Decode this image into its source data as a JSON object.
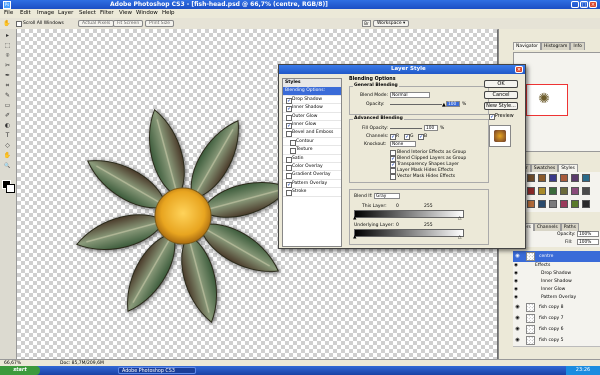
{
  "window": {
    "title": "Adobe Photoshop CS3 - [fish-head.psd @ 66,7% (centre, RGB/8)]"
  },
  "menu": [
    "File",
    "Edit",
    "Image",
    "Layer",
    "Select",
    "Filter",
    "View",
    "Window",
    "Help"
  ],
  "options": {
    "scroll_all": "Scroll All Windows",
    "actual_pixels": "Actual Pixels",
    "fit_screen": "Fit Screen",
    "print_size": "Print Size",
    "workspace": "Workspace ▾"
  },
  "tools": [
    "▸",
    "⬚",
    "⌾",
    "✂",
    "✒",
    "⌗",
    "✎",
    "▭",
    "✐",
    "◐",
    "T",
    "◇",
    "✋",
    "🔍"
  ],
  "dialog": {
    "title": "Layer Style",
    "styles_header": "Styles",
    "styles": [
      {
        "label": "Blending Options: Default",
        "checkbox": false,
        "checked": false,
        "active": true
      },
      {
        "label": "Drop Shadow",
        "checkbox": true,
        "checked": true
      },
      {
        "label": "Inner Shadow",
        "checkbox": true,
        "checked": true
      },
      {
        "label": "Outer Glow",
        "checkbox": true,
        "checked": false
      },
      {
        "label": "Inner Glow",
        "checkbox": true,
        "checked": true
      },
      {
        "label": "Bevel and Emboss",
        "checkbox": true,
        "checked": false
      },
      {
        "label": "Contour",
        "checkbox": true,
        "checked": false,
        "indent": true
      },
      {
        "label": "Texture",
        "checkbox": true,
        "checked": false,
        "indent": true
      },
      {
        "label": "Satin",
        "checkbox": true,
        "checked": false
      },
      {
        "label": "Color Overlay",
        "checkbox": true,
        "checked": false
      },
      {
        "label": "Gradient Overlay",
        "checkbox": true,
        "checked": false
      },
      {
        "label": "Pattern Overlay",
        "checkbox": true,
        "checked": true
      },
      {
        "label": "Stroke",
        "checkbox": true,
        "checked": false
      }
    ],
    "blending_options": "Blending Options",
    "general_blending": "General Blending",
    "blend_mode_label": "Blend Mode:",
    "blend_mode": "Normal",
    "opacity_label": "Opacity:",
    "opacity": "100",
    "percent": "%",
    "advanced_blending": "Advanced Blending",
    "fill_opacity_label": "Fill Opacity:",
    "fill_opacity": "100",
    "channels_label": "Channels:",
    "ch_r": "R",
    "ch_g": "G",
    "ch_b": "B",
    "knockout_label": "Knockout:",
    "knockout": "None",
    "adv_options": [
      {
        "label": "Blend Interior Effects as Group",
        "checked": false
      },
      {
        "label": "Blend Clipped Layers as Group",
        "checked": true
      },
      {
        "label": "Transparency Shapes Layer",
        "checked": true
      },
      {
        "label": "Layer Mask Hides Effects",
        "checked": false
      },
      {
        "label": "Vector Mask Hides Effects",
        "checked": false
      }
    ],
    "blend_if_label": "Blend If:",
    "blend_if": "Gray",
    "this_layer_label": "This Layer:",
    "this_layer_min": "0",
    "this_layer_max": "255",
    "underlying_label": "Underlying Layer:",
    "underlying_min": "0",
    "underlying_max": "255",
    "ok": "OK",
    "cancel": "Cancel",
    "new_style": "New Style...",
    "preview_label": "Preview"
  },
  "panels": {
    "nav_tabs": [
      "Navigator",
      "Histogram",
      "Info"
    ],
    "swatch_tabs": [
      "Color",
      "Swatches",
      "Styles"
    ],
    "swatch_colors": [
      "#6b4a2a",
      "#8a5a2a",
      "#3a3a8a",
      "#a85a3a",
      "#5a3a6a",
      "#2a6a8a",
      "#8a2a2a",
      "#a88a2a",
      "#3a6a3a",
      "#6a6a3a",
      "#8a4a7a",
      "#4a4a4a",
      "#b06a3a",
      "#2a4a6a",
      "#7a7a7a",
      "#9a3a5a",
      "#5a7a2a",
      "#2a2a2a"
    ],
    "layer_tabs": [
      "Layers",
      "Channels",
      "Paths"
    ],
    "opacity_label": "Opacity:",
    "opacity": "100%",
    "fill_label": "Fill:",
    "fill": "100%",
    "layers": [
      {
        "name": "centre",
        "fx": true,
        "selected": true
      },
      {
        "name": "Effects",
        "effect": true
      },
      {
        "name": "Drop Shadow",
        "effect": true
      },
      {
        "name": "Inner Shadow",
        "effect": true
      },
      {
        "name": "Inner Glow",
        "effect": true
      },
      {
        "name": "Pattern Overlay",
        "effect": true
      },
      {
        "name": "fish copy 8",
        "fx": true
      },
      {
        "name": "fish copy 7",
        "fx": true
      },
      {
        "name": "fish copy 6",
        "fx": true
      },
      {
        "name": "fish copy 5",
        "fx": true
      }
    ]
  },
  "status": {
    "zoom": "66,67%",
    "doc": "Doc: 85,7M/209,6M"
  },
  "taskbar": {
    "start": "start",
    "app": "Adobe Photoshop CS3",
    "clock": "23:26"
  },
  "flower": {
    "center_color": "#e8a520",
    "petal_color": "#5b7a5a",
    "petal_count": 8
  }
}
